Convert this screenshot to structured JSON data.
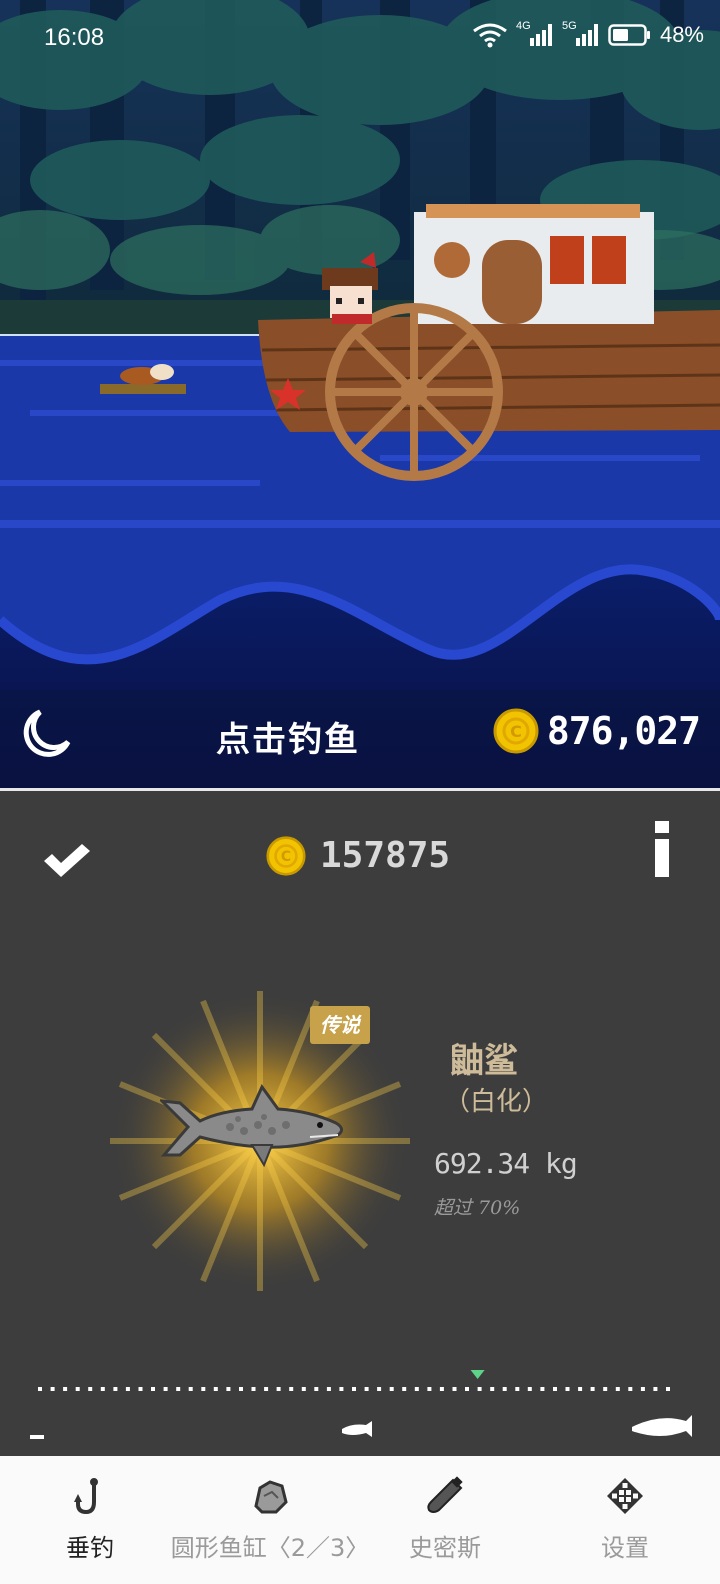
{
  "status_bar": {
    "time": "16:08",
    "network_1": "4G",
    "network_2": "5G",
    "battery": "48%"
  },
  "hud": {
    "tap_label": "点击钓鱼",
    "total_coins": "876,027"
  },
  "catch": {
    "price": "157875",
    "rarity_badge": "传说",
    "fish_name": "鼬鲨",
    "variant": "（白化）",
    "weight": "692.34 kg",
    "percentile": "超过 70%",
    "scale_fraction": 0.7,
    "rarity_color": "#c8a24a"
  },
  "tabs": [
    {
      "label": "垂钓",
      "icon": "hook-icon",
      "active": true
    },
    {
      "label": "圆形鱼缸〈2／3〉",
      "icon": "aquarium-rock-icon",
      "active": false
    },
    {
      "label": "史密斯",
      "icon": "bottle-icon",
      "active": false
    },
    {
      "label": "设置",
      "icon": "settings-gear-icon",
      "active": false
    }
  ],
  "colors": {
    "water": "#1e3bb8",
    "panel": "#3d3d3d",
    "coin": "#f2c300",
    "active_tab": "#222222",
    "inactive_tab": "#9a9a9a",
    "scale_marker": "#5fd28a"
  }
}
